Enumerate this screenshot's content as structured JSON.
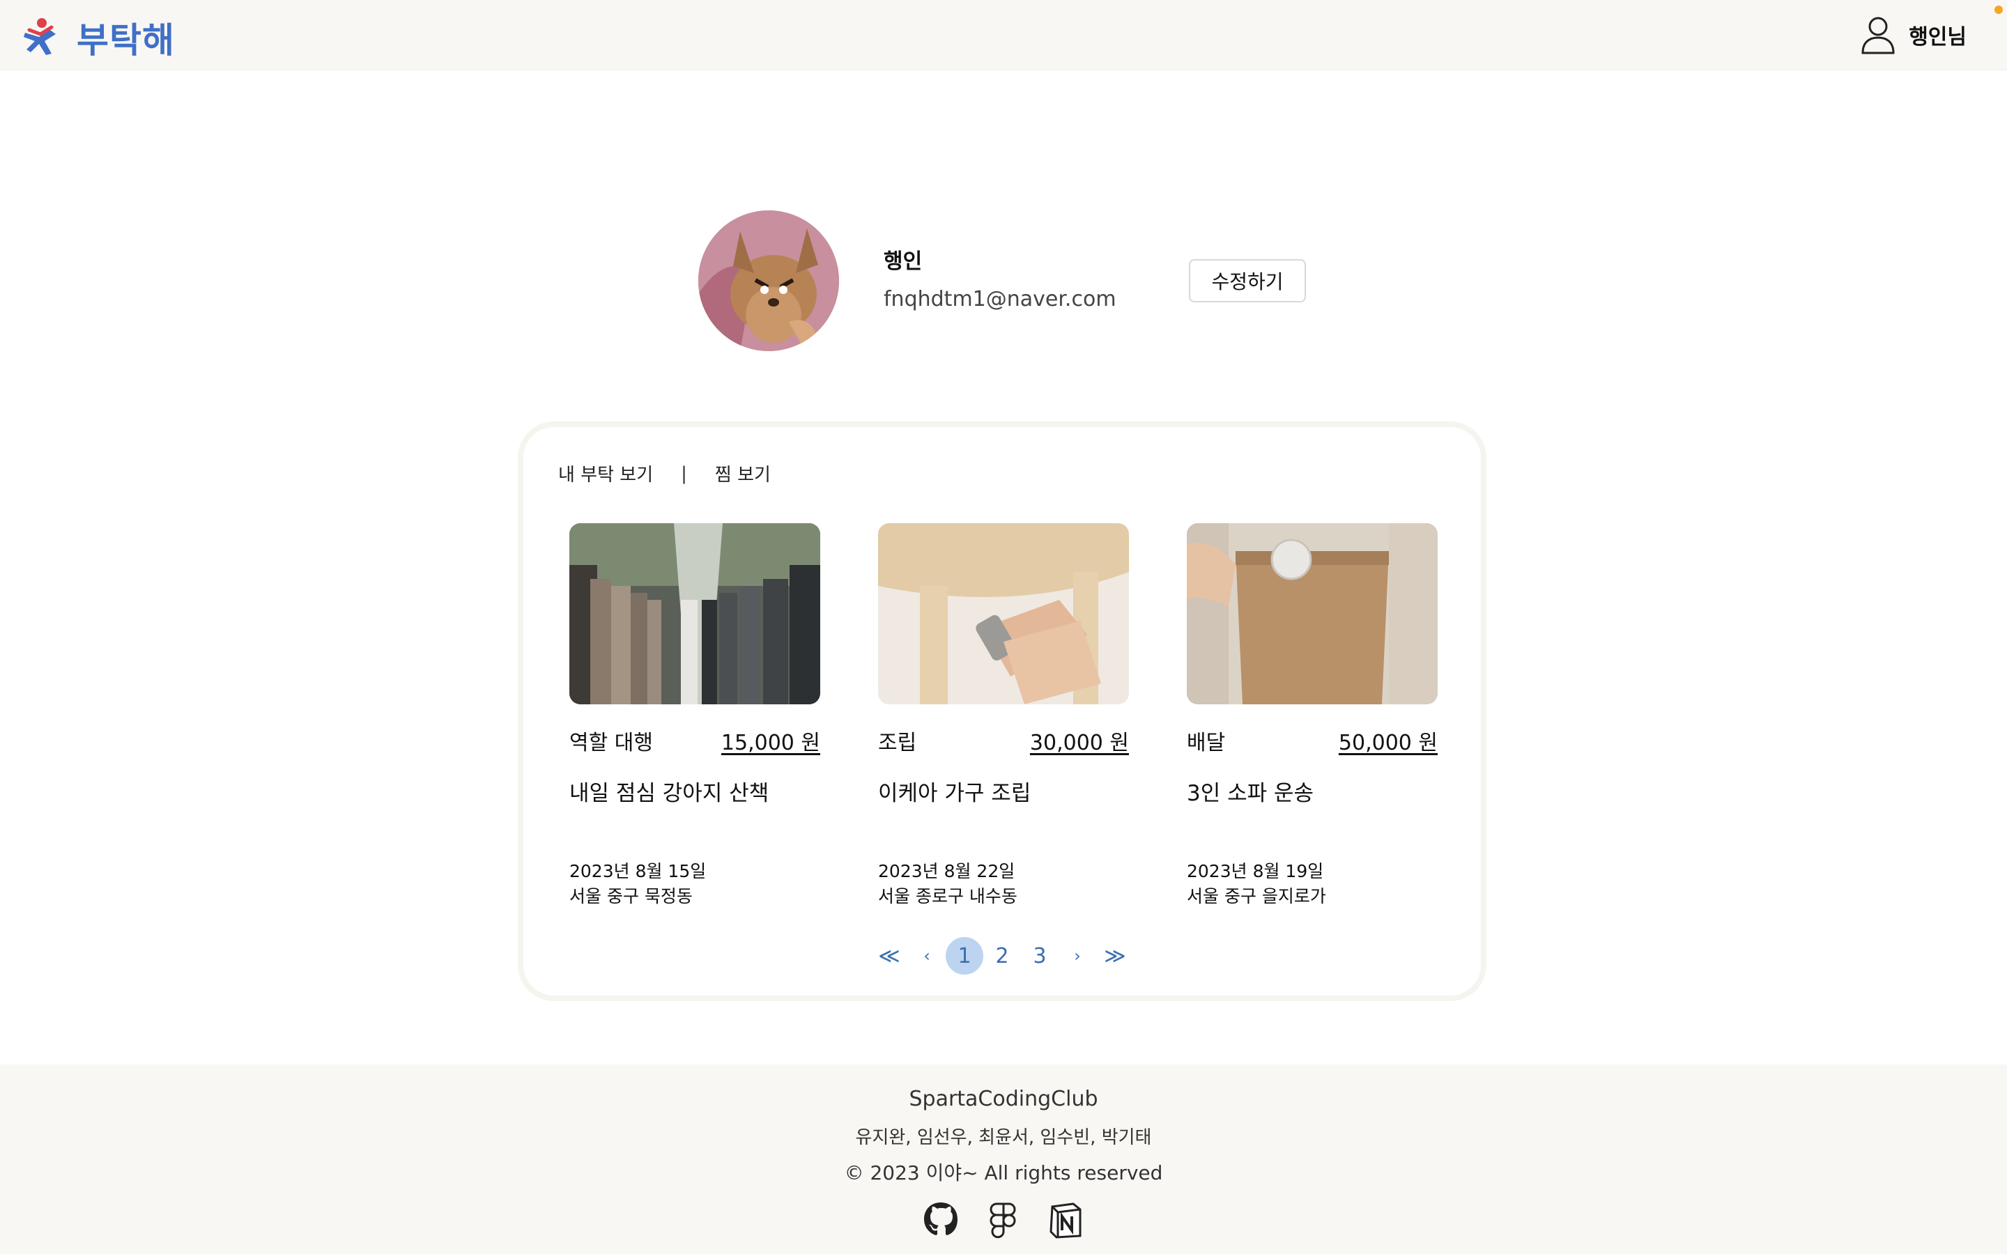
{
  "header": {
    "brand": "부탁해",
    "user_label": "행인님",
    "brand_colors": {
      "blue": "#3f6fc8",
      "red": "#e0404a"
    },
    "notification_color": "#f5a623"
  },
  "profile": {
    "name": "행인",
    "email": "fnqhdtm1@naver.com",
    "edit_label": "수정하기"
  },
  "tabs": {
    "my_requests": "내 부탁 보기",
    "separator": "|",
    "favorites": "찜 보기"
  },
  "cards": [
    {
      "category": "역할 대행",
      "price": "15,000 원",
      "title": "내일 점심 강아지 산책",
      "date": "2023년 8월 15일",
      "location": "서울 중구 묵정동",
      "image": "wedding-photo"
    },
    {
      "category": "조립",
      "price": "30,000 원",
      "title": "이케아 가구 조립",
      "date": "2023년 8월 22일",
      "location": "서울 종로구 내수동",
      "image": "furniture-assembly-photo"
    },
    {
      "category": "배달",
      "price": "50,000 원",
      "title": "3인 소파 운송",
      "date": "2023년 8월 19일",
      "location": "서울 중구 을지로가",
      "image": "paper-bag-photo"
    }
  ],
  "pagination": {
    "first": "≪",
    "prev": "‹",
    "pages": [
      "1",
      "2",
      "3"
    ],
    "current": "1",
    "next": "›",
    "last": "≫",
    "accent": "#bcd4f0"
  },
  "footer": {
    "org": "SpartaCodingClub",
    "members": "유지완, 임선우, 최윤서, 임수빈, 박기태",
    "copyright": "© 2023 이야~ All rights reserved",
    "links": [
      "github-icon",
      "figma-icon",
      "notion-icon"
    ]
  }
}
